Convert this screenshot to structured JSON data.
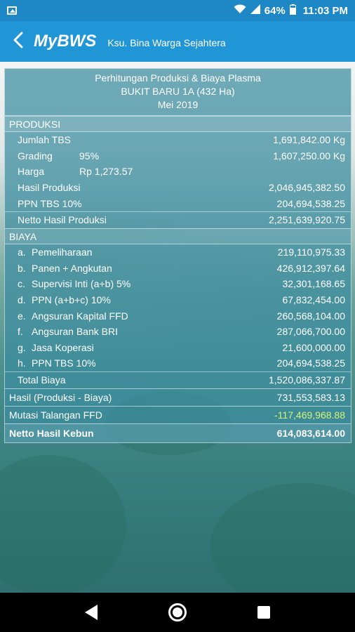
{
  "status": {
    "battery": "64%",
    "time": "11:03 PM"
  },
  "appbar": {
    "title": "MyBWS",
    "subtitle": "Ksu. Bina Warga Sejahtera"
  },
  "report": {
    "title": "Perhitungan Produksi & Biaya Plasma",
    "location": "BUKIT BARU 1A (432 Ha)",
    "period": "Mei 2019",
    "produksi": {
      "header": "PRODUKSI",
      "jumlah_tbs": {
        "label": "Jumlah TBS",
        "value": "1,691,842.00 Kg"
      },
      "grading": {
        "label": "Grading",
        "mid": "95%",
        "value": "1,607,250.00 Kg"
      },
      "harga": {
        "label": "Harga",
        "mid": "Rp 1,273.57",
        "value": ""
      },
      "hasil_produksi": {
        "label": "Hasil Produksi",
        "value": "2,046,945,382.50"
      },
      "ppn_tbs": {
        "label": "PPN TBS 10%",
        "value": "204,694,538.25"
      },
      "netto": {
        "label": "Netto Hasil Produksi",
        "value": "2,251,639,920.75"
      }
    },
    "biaya": {
      "header": "BIAYA",
      "items": [
        {
          "prefix": "a.",
          "label": "Pemeliharaan",
          "value": "219,110,975.33"
        },
        {
          "prefix": "b.",
          "label": "Panen + Angkutan",
          "value": "426,912,397.64"
        },
        {
          "prefix": "c.",
          "label": "Supervisi Inti (a+b) 5%",
          "value": "32,301,168.65"
        },
        {
          "prefix": "d.",
          "label": "PPN (a+b+c) 10%",
          "value": "67,832,454.00"
        },
        {
          "prefix": "e.",
          "label": "Angsuran Kapital FFD",
          "value": "260,568,104.00"
        },
        {
          "prefix": "f.",
          "label": "Angsuran Bank BRI",
          "value": "287,066,700.00"
        },
        {
          "prefix": "g.",
          "label": "Jasa Koperasi",
          "value": "21,600,000.00"
        },
        {
          "prefix": "h.",
          "label": "PPN TBS 10%",
          "value": "204,694,538.25"
        }
      ],
      "total": {
        "label": "Total Biaya",
        "value": "1,520,086,337.87"
      }
    },
    "hasil": {
      "label": "Hasil (Produksi - Biaya)",
      "value": "731,553,583.13"
    },
    "mutasi": {
      "label": "Mutasi Talangan FFD",
      "value": "-117,469,968.88"
    },
    "netto_kebun": {
      "label": "Netto Hasil Kebun",
      "value": "614,083,614.00"
    }
  },
  "colors": {
    "status_bar": "#1e88c7",
    "app_bar": "#2196d6",
    "negative_value": "#d4f57a"
  },
  "icons": [
    "image-icon",
    "wifi-icon",
    "signal-icon",
    "battery-icon",
    "back-arrow-icon",
    "nav-back-icon",
    "nav-home-icon",
    "nav-recents-icon"
  ]
}
